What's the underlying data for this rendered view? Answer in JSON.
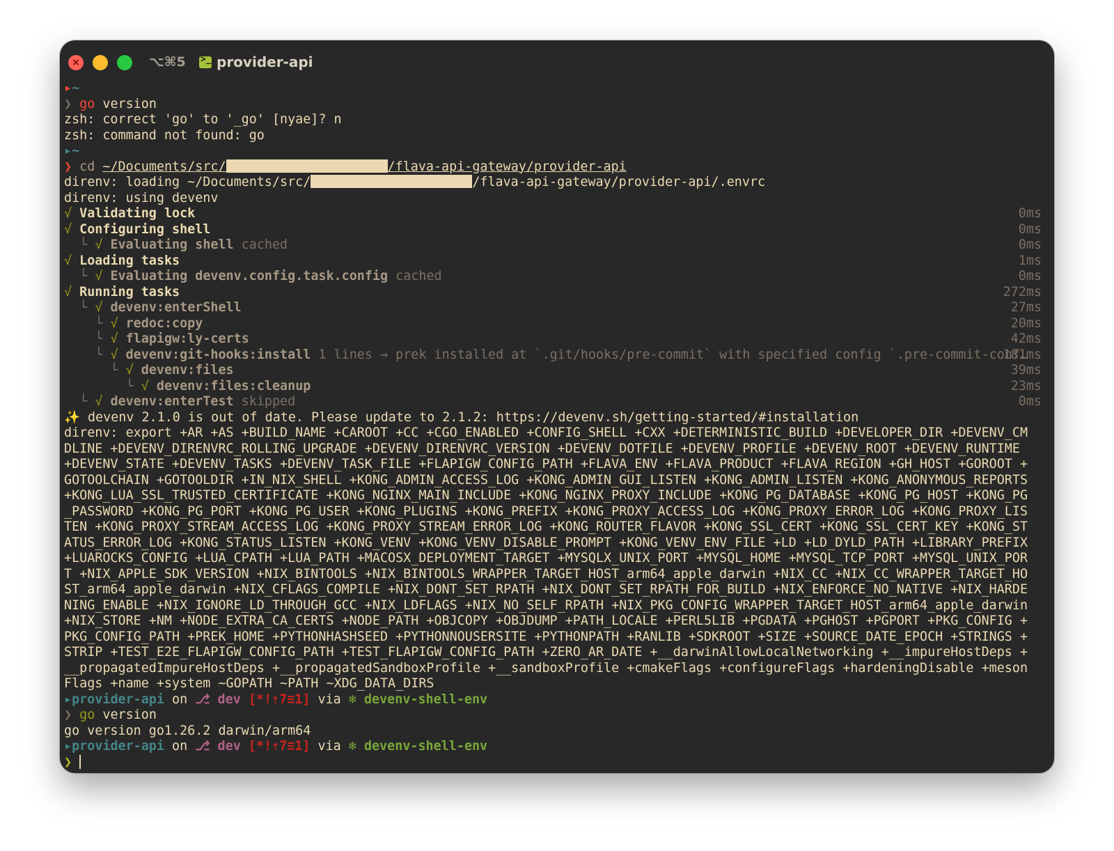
{
  "window": {
    "shortcut": "⌥⌘5",
    "title": "provider-api",
    "close_glyph": "×"
  },
  "prompt": {
    "home": "~",
    "chevron": "❯",
    "dir_name": "provider-api",
    "on": "on",
    "branch_icon": "⎇",
    "branch": "dev",
    "status": "[*!⇡7≡1]",
    "via": "via",
    "env_icon": "❄",
    "env": "devenv-shell-env"
  },
  "lines": {
    "cmd1_word": "go",
    "cmd1_rest": " version",
    "zsh_correct": "zsh: correct 'go' to '_go' [nyae]? n",
    "zsh_notfound": "zsh: command not found: go",
    "cd_cmd": "cd",
    "cd_path_a": "~/Documents/src/",
    "cd_path_b": "/flava-api-gateway/provider-api",
    "direnv_loading_a": "direnv: loading ~/Documents/src/",
    "direnv_loading_b": "/flava-api-gateway/provider-api/.envrc",
    "direnv_using": "direnv: using devenv",
    "update_notice": "✨ devenv 2.1.0 is out of date. Please update to 2.1.2: https://devenv.sh/getting-started/#installation",
    "export_text": "direnv: export +AR +AS +BUILD_NAME +CAROOT +CC +CGO_ENABLED +CONFIG_SHELL +CXX +DETERMINISTIC_BUILD +DEVELOPER_DIR +DEVENV_CMDLINE +DEVENV_DIRENVRC_ROLLING_UPGRADE +DEVENV_DIRENVRC_VERSION +DEVENV_DOTFILE +DEVENV_PROFILE +DEVENV_ROOT +DEVENV_RUNTIME +DEVENV_STATE +DEVENV_TASKS +DEVENV_TASK_FILE +FLAPIGW_CONFIG_PATH +FLAVA_ENV +FLAVA_PRODUCT +FLAVA_REGION +GH_HOST +GOROOT +GOTOOLCHAIN +GOTOOLDIR +IN_NIX_SHELL +KONG_ADMIN_ACCESS_LOG +KONG_ADMIN_GUI_LISTEN +KONG_ADMIN_LISTEN +KONG_ANONYMOUS_REPORTS +KONG_LUA_SSL_TRUSTED_CERTIFICATE +KONG_NGINX_MAIN_INCLUDE +KONG_NGINX_PROXY_INCLUDE +KONG_PG_DATABASE +KONG_PG_HOST +KONG_PG_PASSWORD +KONG_PG_PORT +KONG_PG_USER +KONG_PLUGINS +KONG_PREFIX +KONG_PROXY_ACCESS_LOG +KONG_PROXY_ERROR_LOG +KONG_PROXY_LISTEN +KONG_PROXY_STREAM_ACCESS_LOG +KONG_PROXY_STREAM_ERROR_LOG +KONG_ROUTER_FLAVOR +KONG_SSL_CERT +KONG_SSL_CERT_KEY +KONG_STATUS_ERROR_LOG +KONG_STATUS_LISTEN +KONG_VENV +KONG_VENV_DISABLE_PROMPT +KONG_VENV_ENV_FILE +LD +LD_DYLD_PATH +LIBRARY_PREFIX +LUAROCKS_CONFIG +LUA_CPATH +LUA_PATH +MACOSX_DEPLOYMENT_TARGET +MYSQLX_UNIX_PORT +MYSQL_HOME +MYSQL_TCP_PORT +MYSQL_UNIX_PORT +NIX_APPLE_SDK_VERSION +NIX_BINTOOLS +NIX_BINTOOLS_WRAPPER_TARGET_HOST_arm64_apple_darwin +NIX_CC +NIX_CC_WRAPPER_TARGET_HOST_arm64_apple_darwin +NIX_CFLAGS_COMPILE +NIX_DONT_SET_RPATH +NIX_DONT_SET_RPATH_FOR_BUILD +NIX_ENFORCE_NO_NATIVE +NIX_HARDENING_ENABLE +NIX_IGNORE_LD_THROUGH_GCC +NIX_LDFLAGS +NIX_NO_SELF_RPATH +NIX_PKG_CONFIG_WRAPPER_TARGET_HOST_arm64_apple_darwin +NIX_STORE +NM +NODE_EXTRA_CA_CERTS +NODE_PATH +OBJCOPY +OBJDUMP +PATH_LOCALE +PERL5LIB +PGDATA +PGHOST +PGPORT +PKG_CONFIG +PKG_CONFIG_PATH +PREK_HOME +PYTHONHASHSEED +PYTHONNOUSERSITE +PYTHONPATH +RANLIB +SDKROOT +SIZE +SOURCE_DATE_EPOCH +STRINGS +STRIP +TEST_E2E_FLAPIGW_CONFIG_PATH +TEST_FLAPIGW_CONFIG_PATH +ZERO_AR_DATE +__darwinAllowLocalNetworking +__impureHostDeps +__propagatedImpureHostDeps +__propagatedSandboxProfile +__sandboxProfile +cmakeFlags +configureFlags +hardeningDisable +mesonFlags +name +system ~GOPATH ~PATH ~XDG_DATA_DIRS",
    "cmd2_word": "go",
    "cmd2_rest": " version",
    "go_version_output": "go version go1.26.2 darwin/arm64"
  },
  "tasks": [
    {
      "prefix": "√ ",
      "branch": "",
      "name": "Validating lock",
      "suffix": "",
      "time": "0ms",
      "top": true
    },
    {
      "prefix": "√ ",
      "branch": "",
      "name": "Configuring shell",
      "suffix": "",
      "time": "0ms",
      "top": true
    },
    {
      "prefix": "  ",
      "branch": "└ √ ",
      "name": "Evaluating shell",
      "suffix": " cached",
      "time": "0ms",
      "top": false
    },
    {
      "prefix": "√ ",
      "branch": "",
      "name": "Loading tasks",
      "suffix": "",
      "time": "1ms",
      "top": true
    },
    {
      "prefix": "  ",
      "branch": "└ √ ",
      "name": "Evaluating devenv.config.task.config",
      "suffix": " cached",
      "time": "0ms",
      "top": false
    },
    {
      "prefix": "√ ",
      "branch": "",
      "name": "Running tasks",
      "suffix": "",
      "time": "272ms",
      "top": true
    },
    {
      "prefix": "  ",
      "branch": "└ √ ",
      "name": "devenv:enterShell",
      "suffix": "",
      "time": "27ms",
      "top": false
    },
    {
      "prefix": "    ",
      "branch": "└ √ ",
      "name": "redoc:copy",
      "suffix": "",
      "time": "20ms",
      "top": false
    },
    {
      "prefix": "    ",
      "branch": "└ √ ",
      "name": "flapigw:ly-certs",
      "suffix": "",
      "time": "42ms",
      "top": false
    },
    {
      "prefix": "    ",
      "branch": "└ √ ",
      "name": "devenv:git-hooks:install",
      "suffix": " 1 lines → prek installed at `.git/hooks/pre-commit` with specified config `.pre-commit-conf…",
      "time": "181ms",
      "top": false
    },
    {
      "prefix": "      ",
      "branch": "└ √ ",
      "name": "devenv:files",
      "suffix": "",
      "time": "39ms",
      "top": false
    },
    {
      "prefix": "        ",
      "branch": "└ √ ",
      "name": "devenv:files:cleanup",
      "suffix": "",
      "time": "23ms",
      "top": false
    },
    {
      "prefix": "  ",
      "branch": "└ √ ",
      "name": "devenv:enterTest",
      "suffix": " skipped",
      "time": "0ms",
      "top": false
    }
  ],
  "colors": {
    "background": "#282828",
    "foreground": "#ebdbb2",
    "error_red": "#fb4934",
    "check_green": "#98971a",
    "prompt_dir": "#458588",
    "branch": "#b16286",
    "env": "#79a83a",
    "redaction": "#ecd9b3"
  },
  "icons": {
    "close": "close-icon",
    "minimize": "minimize-icon",
    "maximize": "maximize-icon",
    "tab": "terminal-icon",
    "branch": "git-branch-icon",
    "env": "snowflake-icon"
  }
}
